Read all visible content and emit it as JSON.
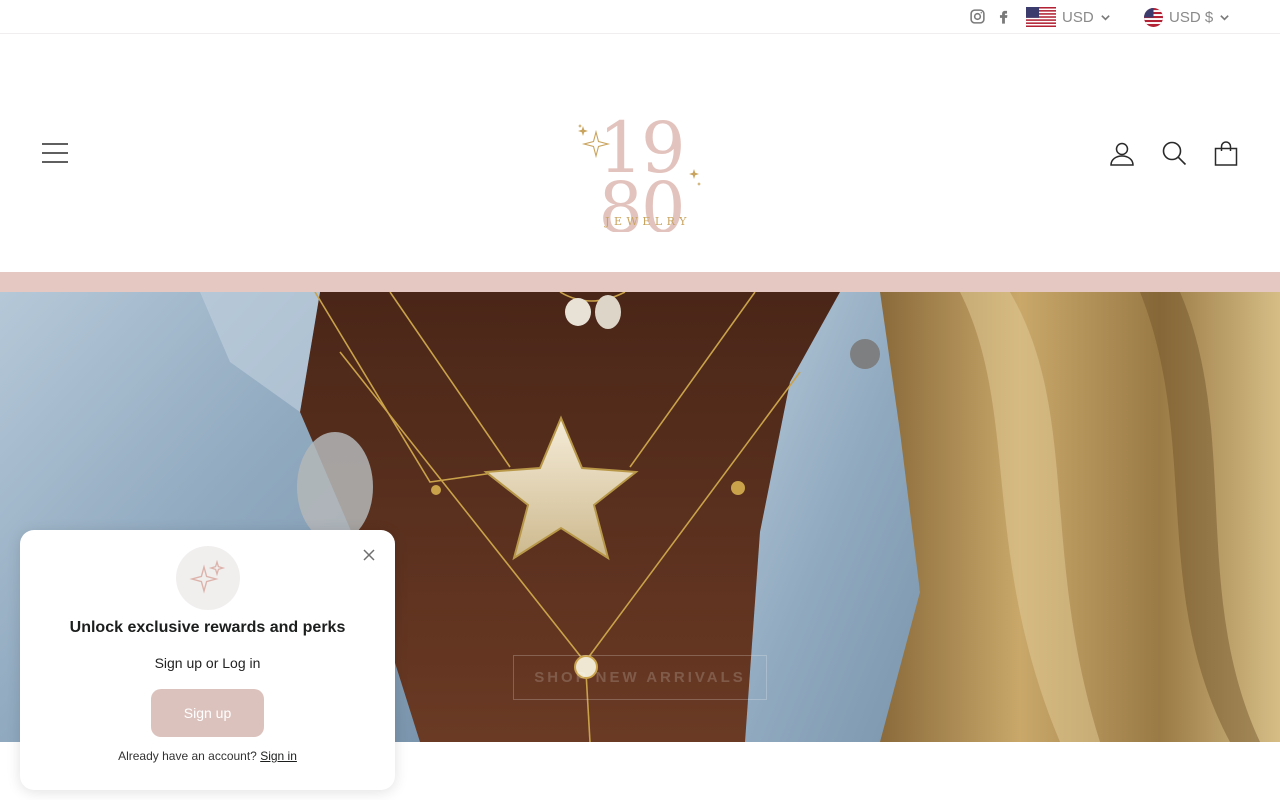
{
  "topbar": {
    "social": [
      "instagram-icon",
      "facebook-icon"
    ],
    "currency_primary": {
      "label": "USD",
      "flag": "us-flag-icon"
    },
    "currency_secondary": {
      "label": "USD $",
      "flag": "us-flag-round-icon"
    }
  },
  "header": {
    "logo": {
      "top": "19",
      "bottom": "80",
      "word": "JEWELRY"
    },
    "icons": [
      "menu-icon",
      "account-icon",
      "search-icon",
      "cart-icon"
    ]
  },
  "hero": {
    "button_label": "SHOP NEW ARRIVALS"
  },
  "popup": {
    "title": "Unlock exclusive rewards and perks",
    "subtitle": "Sign up or Log in",
    "signup_label": "Sign up",
    "footer_text": "Already have an account?",
    "signin_label": "Sign in"
  },
  "colors": {
    "brand_pink": "#e6c8c2",
    "button_pink": "#dcc2bd",
    "logo_pink": "#e3c3bd",
    "logo_gold": "#c9a45f"
  }
}
